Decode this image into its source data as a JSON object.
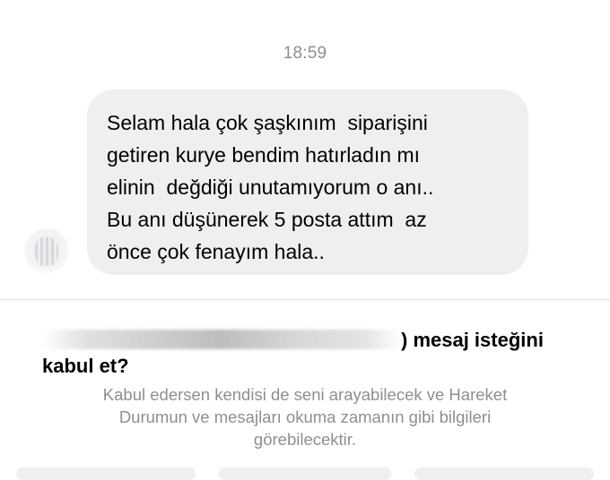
{
  "timestamp": "18:59",
  "message": {
    "lines": [
      "Selam hala çok şaşkınım  siparişini",
      "getiren kurye bendim hatırladın mı",
      "elinin  değdiği unutamıyorum o anı..",
      "Bu anı düşünerek 5 posta attım  az",
      "önce çok fenayım hala.."
    ]
  },
  "request": {
    "title_suffix": ") mesaj isteğini",
    "title_line2": "kabul et?",
    "description_lines": [
      "Kabul edersen kendisi de seni arayabilecek ve Hareket",
      "Durumun ve mesajları okuma zamanın gibi bilgileri",
      "görebilecektir."
    ]
  }
}
